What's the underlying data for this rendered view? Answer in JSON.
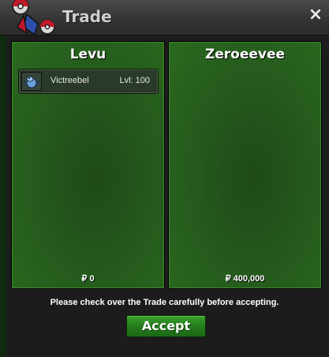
{
  "window": {
    "title": "Trade",
    "close_label": "×"
  },
  "trade": {
    "left": {
      "player": "Levu",
      "pokemon": [
        {
          "name": "Victreebel",
          "level": "Lvl: 100",
          "icon": "victreebel-sprite-icon"
        }
      ],
      "money": "₽ 0"
    },
    "right": {
      "player": "Zeroeevee",
      "pokemon": [],
      "money": "₽ 400,000"
    }
  },
  "notice": "Please check over the Trade carefully before accepting.",
  "accept_label": "Accept"
}
